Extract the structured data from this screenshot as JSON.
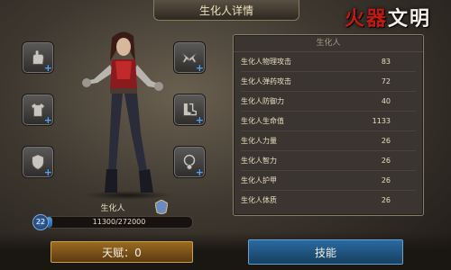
{
  "header": {
    "title": "生化人详情",
    "logo_text_1": "火器",
    "logo_text_2": "文明"
  },
  "character": {
    "name": "生化人",
    "level": "22",
    "xp_text": "11300/272000",
    "xp_fraction": 0.0415
  },
  "stats": {
    "title": "生化人",
    "rows": [
      {
        "label": "生化人物理攻击",
        "value": "83"
      },
      {
        "label": "生化人弹药攻击",
        "value": "72"
      },
      {
        "label": "生化人防御力",
        "value": "40"
      },
      {
        "label": "生化人生命值",
        "value": "1133"
      },
      {
        "label": "生化人力量",
        "value": "26"
      },
      {
        "label": "生化人智力",
        "value": "26"
      },
      {
        "label": "生化人护甲",
        "value": "26"
      },
      {
        "label": "生化人体质",
        "value": "26"
      }
    ]
  },
  "buttons": {
    "talent_label": "天赋：0",
    "skill_label": "技能"
  },
  "slots": {
    "left": [
      "glove-icon",
      "armor-icon",
      "shield-icon"
    ],
    "right": [
      "pistols-icon",
      "boots-icon",
      "necklace-icon"
    ]
  },
  "colors": {
    "accent_blue": "#4ea3ff",
    "talent_gold": "#9a6a20",
    "skill_blue": "#2a6aa0",
    "logo_red": "#c21a10"
  }
}
